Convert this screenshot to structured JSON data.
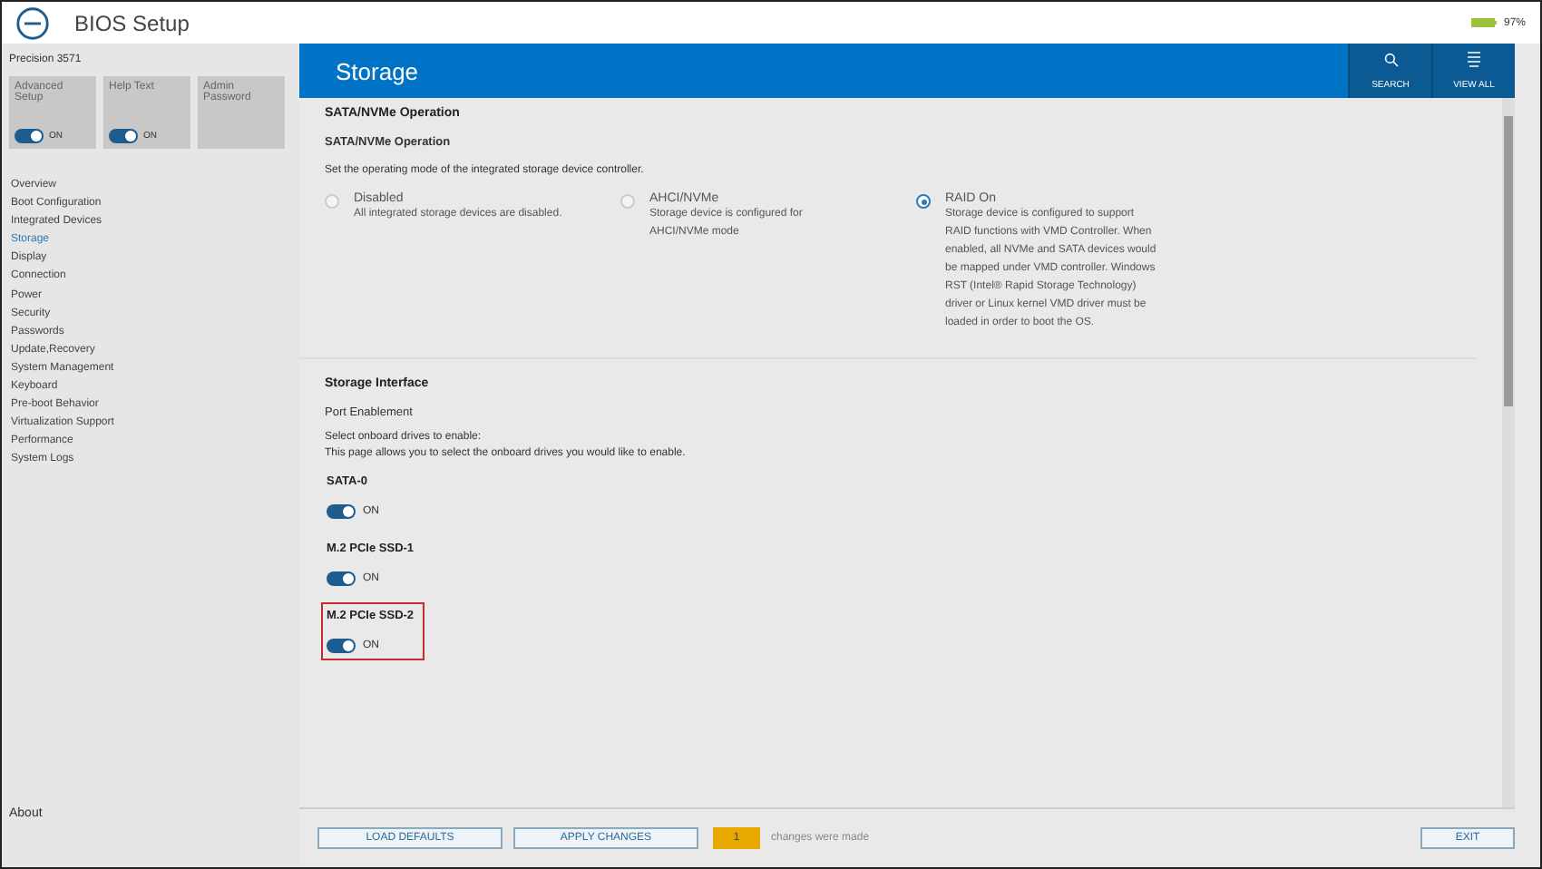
{
  "window": {
    "title": "BIOS Setup",
    "battery_text": "97%"
  },
  "sidebar": {
    "model": "Precision 3571",
    "tiles": [
      {
        "label": "Advanced Setup",
        "kind": "toggle",
        "on": true,
        "state_text": "ON"
      },
      {
        "label": "Help Text",
        "kind": "toggle",
        "on": true,
        "state_text": "ON"
      },
      {
        "label": "Admin Password",
        "kind": "plain"
      }
    ],
    "items": [
      {
        "label": "Overview",
        "selected": false
      },
      {
        "label": "Boot Configuration",
        "selected": false
      },
      {
        "label": "Integrated Devices",
        "selected": false
      },
      {
        "label": "Storage",
        "selected": true
      },
      {
        "label": "Display",
        "selected": false
      },
      {
        "label": "Connection",
        "selected": false
      },
      {
        "label": "Power",
        "selected": false
      },
      {
        "label": "Security",
        "selected": false
      },
      {
        "label": "Passwords",
        "selected": false
      },
      {
        "label": "Update,Recovery",
        "selected": false
      },
      {
        "label": "System Management",
        "selected": false
      },
      {
        "label": "Keyboard",
        "selected": false
      },
      {
        "label": "Pre-boot Behavior",
        "selected": false
      },
      {
        "label": "Virtualization Support",
        "selected": false
      },
      {
        "label": "Performance",
        "selected": false
      },
      {
        "label": "System Logs",
        "selected": false
      }
    ],
    "about": "About"
  },
  "page": {
    "title": "Storage",
    "tools": [
      {
        "label": "SEARCH",
        "kind": "search"
      },
      {
        "label": "VIEW ALL",
        "kind": "list"
      }
    ]
  },
  "sata": {
    "heading": "SATA/NVMe Operation",
    "subheading": "SATA/NVMe Operation",
    "description": "Set the operating mode of the integrated storage device controller.",
    "options": [
      {
        "label": "Disabled",
        "description": "All integrated storage devices are disabled.",
        "selected": false
      },
      {
        "label": "AHCI/NVMe",
        "description": "Storage device is configured for AHCI/NVMe mode",
        "selected": false
      },
      {
        "label": "RAID On",
        "description": "Storage device is configured to support RAID functions with VMD Controller. When enabled, all NVMe and SATA devices would be mapped under VMD controller. Windows RST (Intel® Rapid Storage Technology) driver or Linux kernel VMD driver must be loaded in order to boot the OS.",
        "selected": true
      }
    ]
  },
  "interface": {
    "heading": "Storage Interface",
    "subheading": "Port Enablement",
    "description_lines": [
      "Select onboard drives to enable:",
      "This page allows you to select the onboard drives you would like to enable."
    ],
    "drives": [
      {
        "name": "SATA-0",
        "on": true,
        "state_text": "ON",
        "highlighted": false
      },
      {
        "name": "M.2 PCIe SSD-1",
        "on": true,
        "state_text": "ON",
        "highlighted": false
      },
      {
        "name": "M.2 PCIe SSD-2",
        "on": true,
        "state_text": "ON",
        "highlighted": true
      }
    ]
  },
  "footer": {
    "buttons": [
      "LOAD DEFAULTS",
      "APPLY CHANGES"
    ],
    "change_count": "1",
    "change_text": "changes were made",
    "exit": "EXIT"
  }
}
